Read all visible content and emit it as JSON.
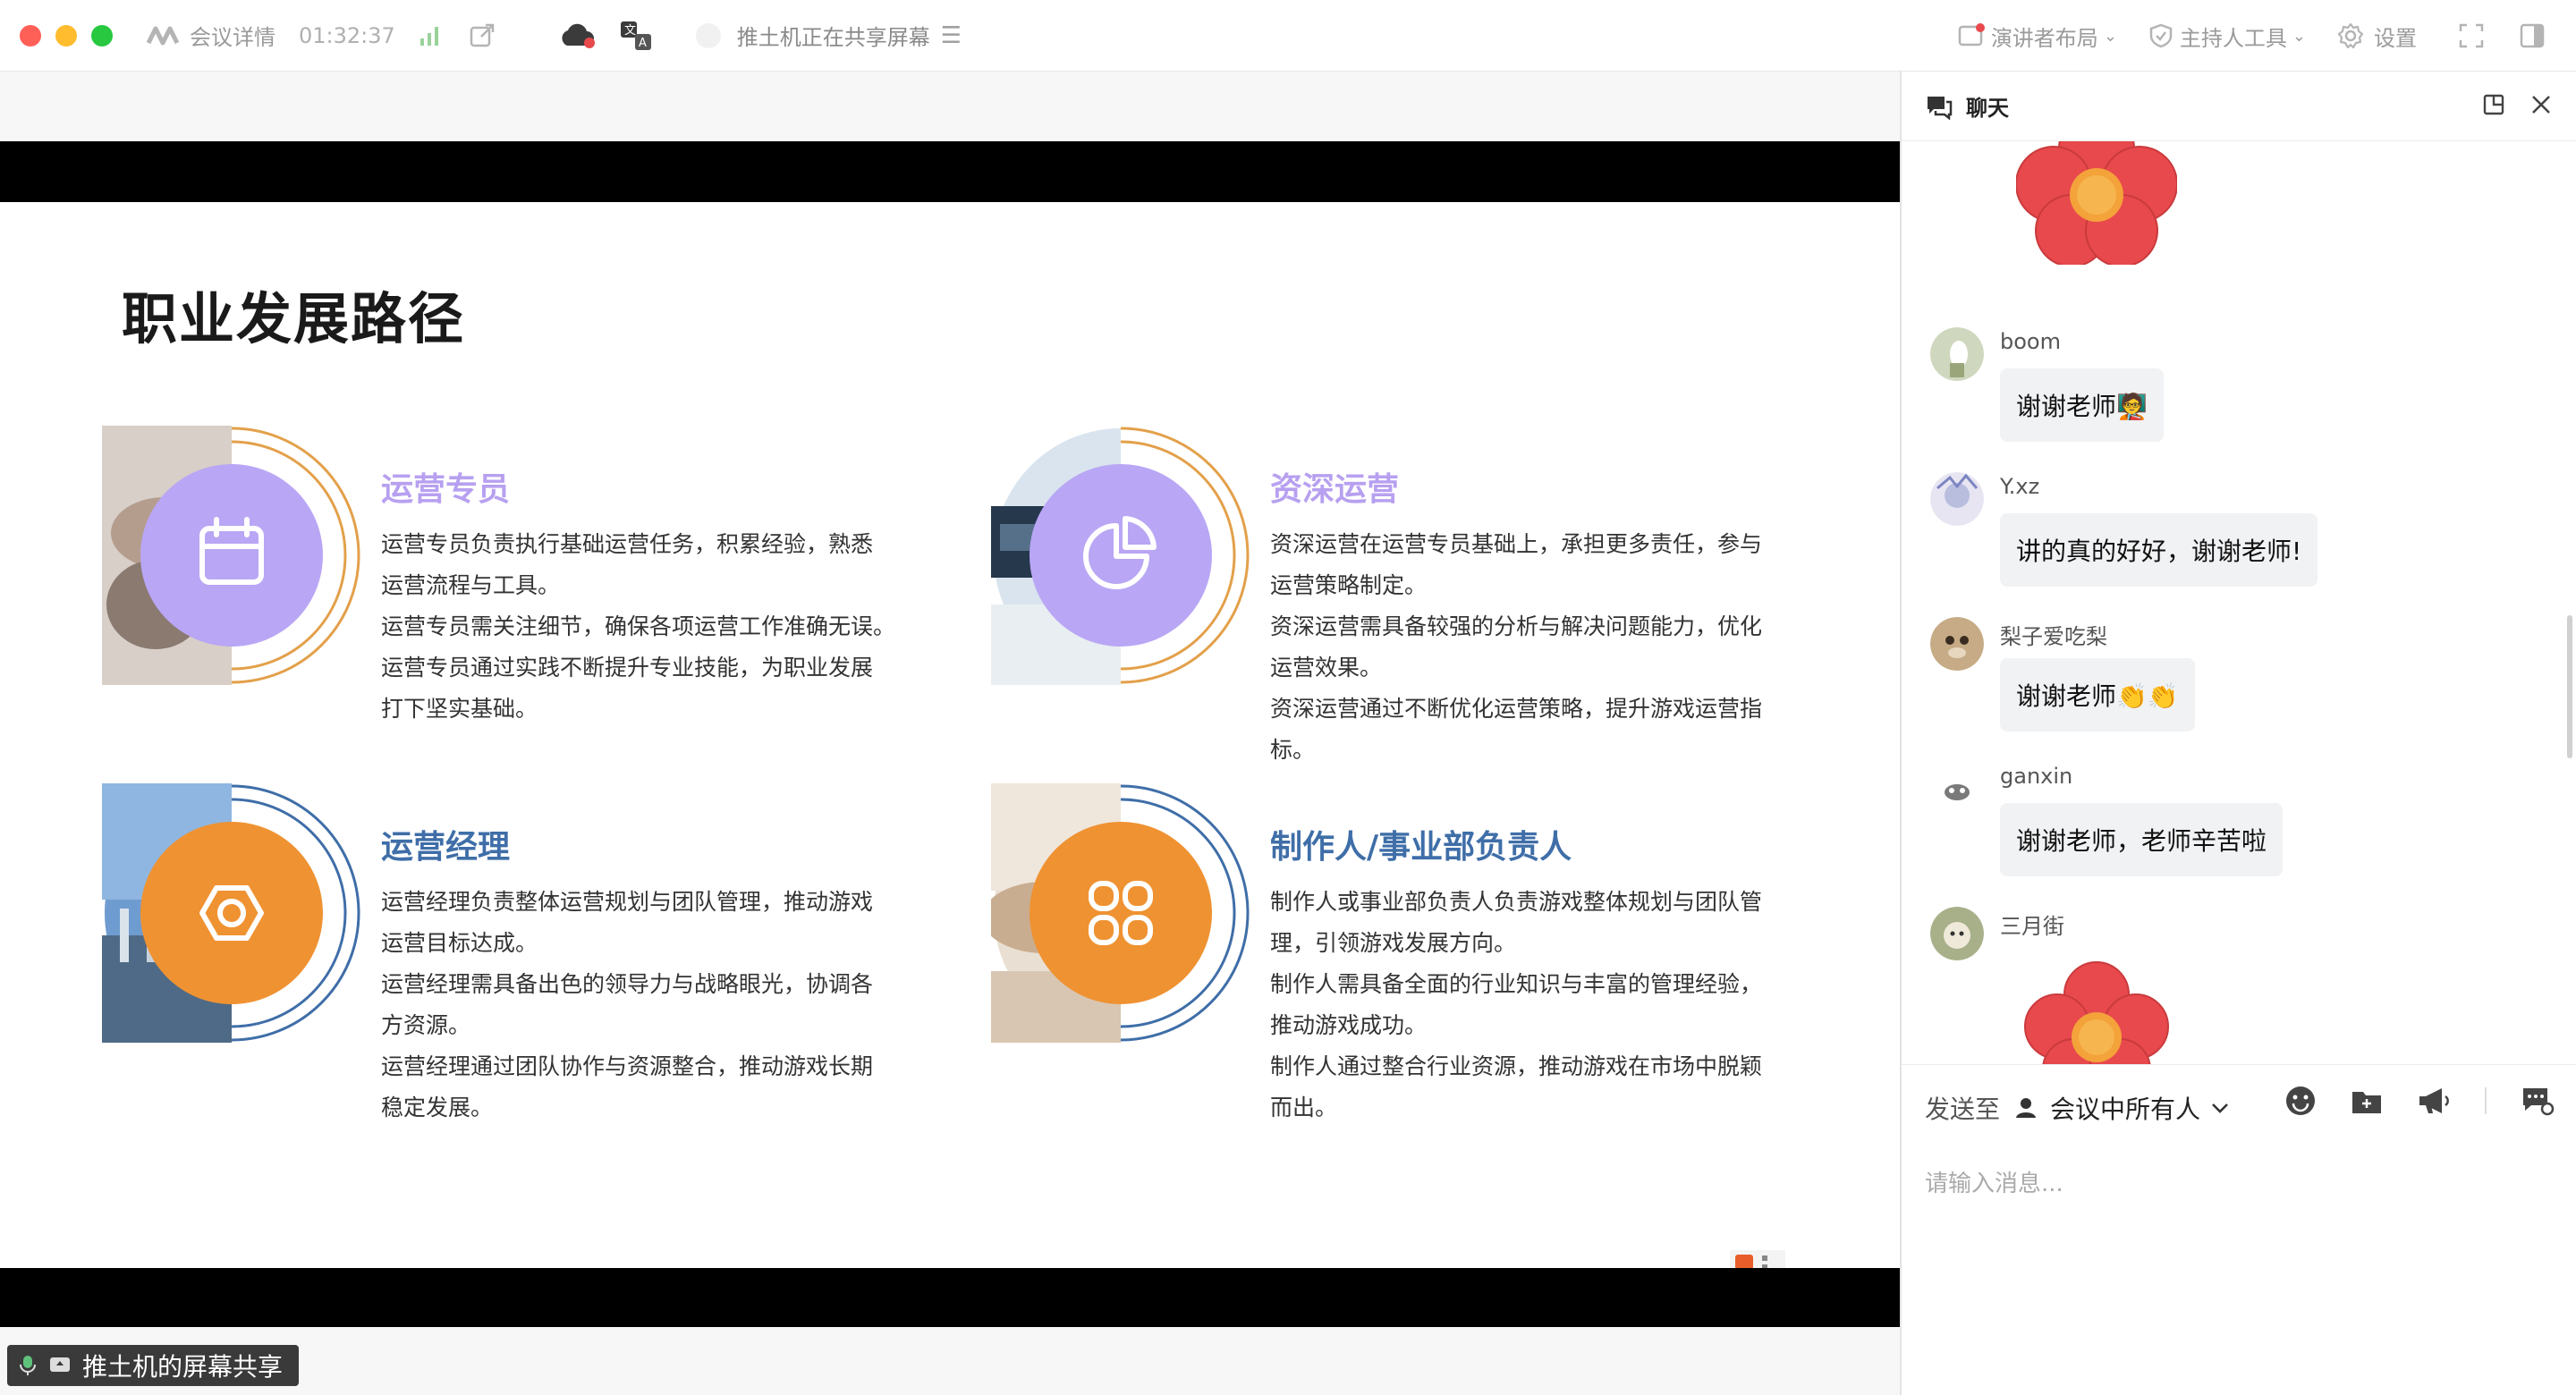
{
  "topbar": {
    "meeting_details": "会议详情",
    "timer": "01:32:37",
    "sharing_status": "推土机正在共享屏幕",
    "speaker_layout": "演讲者布局",
    "host_tools": "主持人工具",
    "settings": "设置"
  },
  "slide": {
    "title": "职业发展路径",
    "cards": [
      {
        "title": "运营专员",
        "title_color": "#b7a0f0",
        "circle_color": "#b9a6f5",
        "ring_color": "#e3a04a",
        "lines": [
          "运营专员负责执行基础运营任务，积累经验，熟悉",
          "运营流程与工具。",
          "运营专员需关注细节，确保各项运营工作准确无误。",
          "运营专员通过实践不断提升专业技能，为职业发展",
          "打下坚实基础。"
        ]
      },
      {
        "title": "资深运营",
        "title_color": "#b7a0f0",
        "circle_color": "#b9a6f5",
        "ring_color": "#e3a04a",
        "lines": [
          "资深运营在运营专员基础上，承担更多责任，参与",
          "运营策略制定。",
          "资深运营需具备较强的分析与解决问题能力，优化",
          "运营效果。",
          "资深运营通过不断优化运营策略，提升游戏运营指",
          "标。"
        ]
      },
      {
        "title": "运营经理",
        "title_color": "#3f6ea8",
        "circle_color": "#ef9232",
        "ring_color": "#3f6ea8",
        "lines": [
          "运营经理负责整体运营规划与团队管理，推动游戏",
          "运营目标达成。",
          "运营经理需具备出色的领导力与战略眼光，协调各",
          "方资源。",
          "运营经理通过团队协作与资源整合，推动游戏长期",
          "稳定发展。"
        ]
      },
      {
        "title": "制作人/事业部负责人",
        "title_color": "#3f6ea8",
        "circle_color": "#ef9232",
        "ring_color": "#3f6ea8",
        "lines": [
          "制作人或事业部负责人负责游戏整体规划与团队管",
          "理，引领游戏发展方向。",
          "制作人需具备全面的行业知识与丰富的管理经验，",
          "推动游戏成功。",
          "制作人通过整合行业资源，推动游戏在市场中脱颖",
          "而出。"
        ]
      }
    ]
  },
  "share_tag": "推土机的屏幕共享",
  "chat": {
    "title": "聊天",
    "messages": [
      {
        "user": "boom",
        "text": "谢谢老师🧑‍🏫"
      },
      {
        "user": "Y.xz",
        "text": "讲的真的好好，谢谢老师!"
      },
      {
        "user": "梨子爱吃梨",
        "text": "谢谢老师👏👏"
      },
      {
        "user": "ganxin",
        "text": "谢谢老师，老师辛苦啦"
      },
      {
        "user": "三月街",
        "text": ""
      }
    ],
    "send_to_label": "发送至",
    "send_to_target": "会议中所有人",
    "input_placeholder": "请输入消息..."
  },
  "colors": {
    "close_dot": "#fe5f57",
    "minimize_dot": "#febc2e",
    "zoom_dot": "#28c840",
    "flower": "#e8494c"
  }
}
